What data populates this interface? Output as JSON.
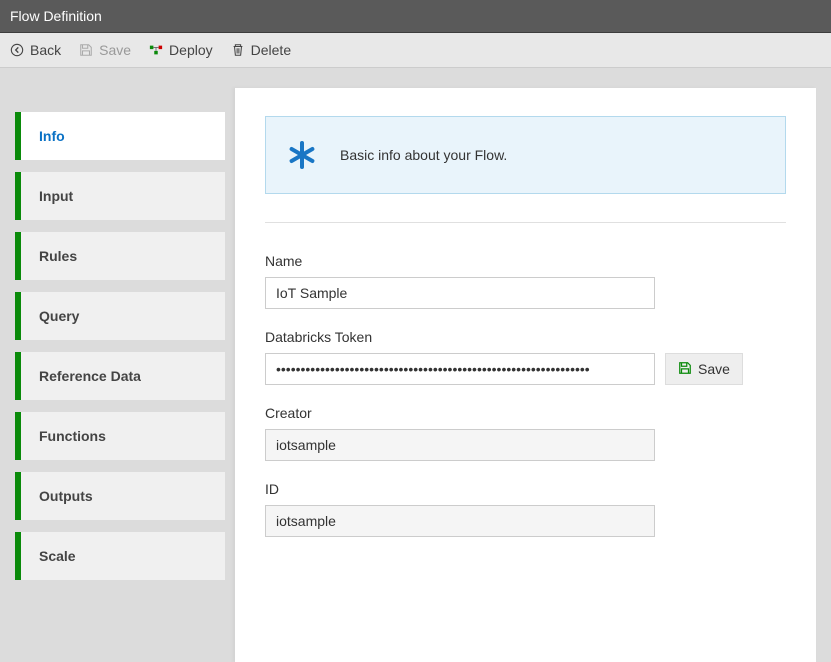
{
  "header": {
    "title": "Flow Definition"
  },
  "toolbar": {
    "back": "Back",
    "save": "Save",
    "deploy": "Deploy",
    "delete": "Delete"
  },
  "sidebar": {
    "items": [
      {
        "label": "Info",
        "active": true
      },
      {
        "label": "Input",
        "active": false
      },
      {
        "label": "Rules",
        "active": false
      },
      {
        "label": "Query",
        "active": false
      },
      {
        "label": "Reference Data",
        "active": false
      },
      {
        "label": "Functions",
        "active": false
      },
      {
        "label": "Outputs",
        "active": false
      },
      {
        "label": "Scale",
        "active": false
      }
    ]
  },
  "info_panel": {
    "message": "Basic info about your Flow."
  },
  "form": {
    "name_label": "Name",
    "name_value": "IoT Sample",
    "token_label": "Databricks Token",
    "token_value": "••••••••••••••••••••••••••••••••••••••••••••••••••••••••••••••••",
    "token_save": "Save",
    "creator_label": "Creator",
    "creator_value": "iotsample",
    "id_label": "ID",
    "id_value": "iotsample"
  }
}
